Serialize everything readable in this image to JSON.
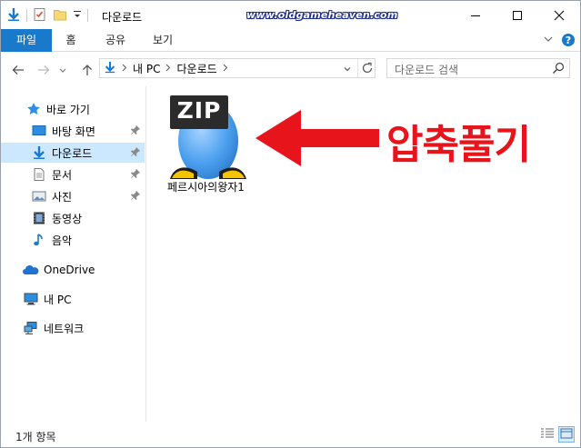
{
  "window": {
    "title": "다운로드",
    "watermark": "www.oldgameheaven.com"
  },
  "ribbon": {
    "tabs": [
      "파일",
      "홈",
      "공유",
      "보기"
    ]
  },
  "address": {
    "segments": [
      "내 PC",
      "다운로드"
    ]
  },
  "search": {
    "placeholder": "다운로드 검색"
  },
  "nav": {
    "items": [
      {
        "label": "바로 가기",
        "icon": "star-icon"
      },
      {
        "label": "바탕 화면",
        "icon": "desktop-icon",
        "pinned": true
      },
      {
        "label": "다운로드",
        "icon": "download-icon",
        "pinned": true,
        "selected": true
      },
      {
        "label": "문서",
        "icon": "document-icon",
        "pinned": true
      },
      {
        "label": "사진",
        "icon": "pictures-icon",
        "pinned": true
      },
      {
        "label": "동영상",
        "icon": "video-icon"
      },
      {
        "label": "음악",
        "icon": "music-icon"
      },
      {
        "label": "OneDrive",
        "icon": "onedrive-icon"
      },
      {
        "label": "내 PC",
        "icon": "pc-icon"
      },
      {
        "label": "네트워크",
        "icon": "network-icon"
      }
    ]
  },
  "files": [
    {
      "name": "페르시아의왕자1",
      "badge": "ZIP",
      "icon": "zip-file-icon"
    }
  ],
  "annotation": {
    "text": "압축풀기",
    "color": "#e8141b"
  },
  "status": {
    "count": "1개 항목"
  },
  "colors": {
    "accent": "#1979ca",
    "selected": "#cce8ff"
  }
}
